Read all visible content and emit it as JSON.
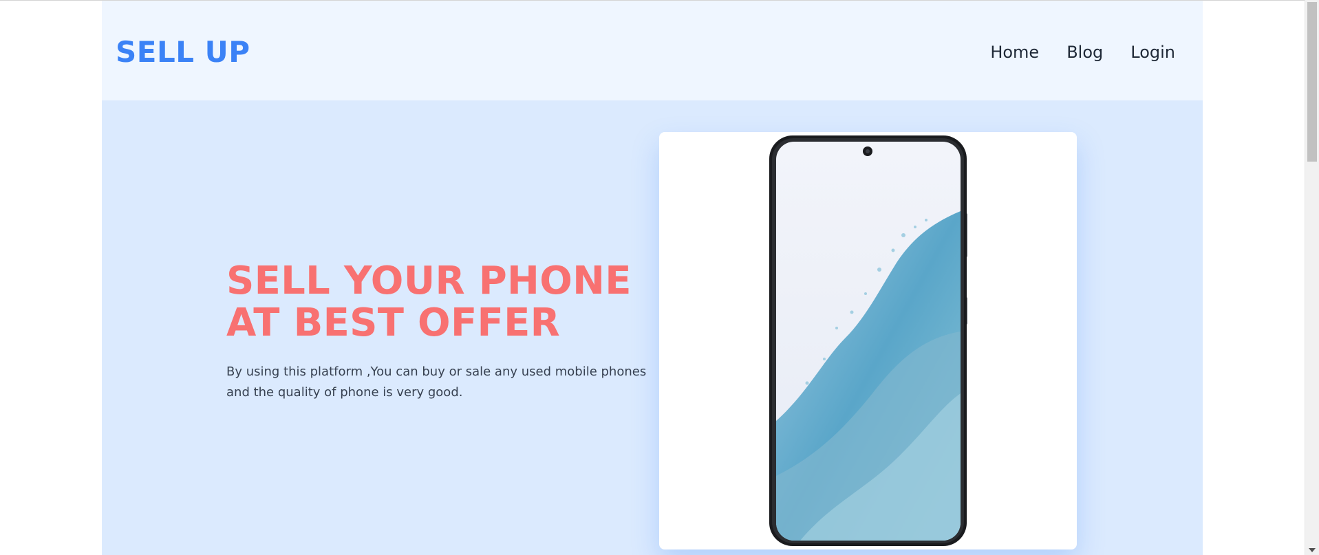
{
  "header": {
    "brand": "SELL UP",
    "nav": [
      {
        "label": "Home"
      },
      {
        "label": "Blog"
      },
      {
        "label": "Login"
      }
    ]
  },
  "hero": {
    "title": "SELL YOUR PHONE\nAT BEST OFFER",
    "description": "By using this platform ,You can buy or sale any used mobile phones and the quality of phone is very good.",
    "image_icon": "smartphone-image"
  },
  "colors": {
    "brand": "#3b82f6",
    "accent": "#f87171",
    "nav_bg": "#eff6ff",
    "hero_bg": "#dbeafe"
  }
}
